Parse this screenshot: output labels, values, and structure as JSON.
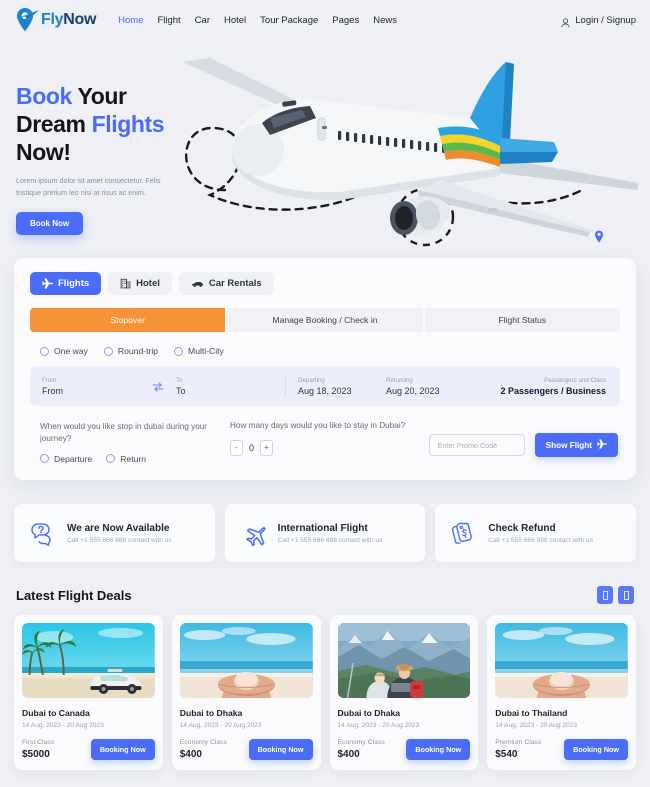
{
  "header": {
    "logo_text_a": "Fly",
    "logo_text_b": "Now",
    "logo_icon": "pin-plane-icon",
    "nav": [
      {
        "label": "Home",
        "active": true
      },
      {
        "label": "Flight",
        "active": false
      },
      {
        "label": "Car",
        "active": false
      },
      {
        "label": "Hotel",
        "active": false
      },
      {
        "label": "Tour Package",
        "active": false
      },
      {
        "label": "Pages",
        "active": false
      },
      {
        "label": "News",
        "active": false
      }
    ],
    "login_label": "Login / Signup",
    "user_icon": "user-icon"
  },
  "hero": {
    "title_line1_a": "Book",
    "title_line1_b": " Your",
    "title_line2_a": "Dream ",
    "title_line2_b": "Flights",
    "title_line3": "Now!",
    "subtitle": "Lorem ipsum dolor sit amet consectetur. Felis tristique pretium leo nisi at risus ac enim.",
    "cta_label": "Book Now",
    "airplane_icon": "airplane-illustration",
    "pin_icon": "location-pin-icon"
  },
  "booking": {
    "segment_tabs": [
      {
        "label": "Flights",
        "icon": "plane-icon",
        "active": true
      },
      {
        "label": "Hotel",
        "icon": "building-icon",
        "active": false
      },
      {
        "label": "Car Rentals",
        "icon": "car-icon",
        "active": false
      }
    ],
    "mode_tabs": [
      {
        "label": "Stopover",
        "active": true
      },
      {
        "label": "Manage Booking / Check in",
        "active": false
      },
      {
        "label": "Flight Status",
        "active": false
      }
    ],
    "trip_types": [
      {
        "label": "One way",
        "selected": false
      },
      {
        "label": "Round-trip",
        "selected": false
      },
      {
        "label": "Multi-City",
        "selected": false
      }
    ],
    "fields": {
      "from_label": "From",
      "from_value": "From",
      "to_label": "To",
      "to_value": "To",
      "swap_icon": "swap-arrows-icon",
      "departing_label": "Departing",
      "departing_value": "Aug 18, 2023",
      "returning_label": "Returning",
      "returning_value": "Aug 20, 2023",
      "passengers_label": "Passengers and Class",
      "passengers_value": "2 Passengers / Business"
    },
    "stopover_question": "When would you like stop in dubai during your journey?",
    "stopover_options": [
      {
        "label": "Departure",
        "selected": false
      },
      {
        "label": "Return",
        "selected": false
      }
    ],
    "days_question": "How many days would you like to stay in Dubai?",
    "days_minus": "-",
    "days_value": "0",
    "days_plus": "+",
    "promo_placeholder": "Enter Promo Code",
    "promo_value": "",
    "show_flight_label": "Show Flight",
    "show_flight_icon": "plane-icon"
  },
  "features": [
    {
      "title": "We are Now Available",
      "subtitle": "Call +1 555 666 888 contact with us",
      "icon": "chat-question-icon"
    },
    {
      "title": "International Flight",
      "subtitle": "Call +1 555 666 888 contact with us",
      "icon": "airplane-icon"
    },
    {
      "title": "Check Refund",
      "subtitle": "Call +1 555 666 888 contact with us",
      "icon": "price-tag-dollar-icon"
    }
  ],
  "deals_section": {
    "title": "Latest Flight Deals",
    "prev_icon": "chevron-left-icon",
    "next_icon": "chevron-right-icon",
    "cards": [
      {
        "name": "Dubai to Canada",
        "dates": "14 Aug, 2023 - 20 Aug 2023",
        "class": "First Class",
        "price": "$5000",
        "button": "Booking Now",
        "image": "beach-palms-car-photo"
      },
      {
        "name": "Dubai to Dhaka",
        "dates": "14 Aug, 2023 - 20 Aug 2023",
        "class": "Economy Class",
        "price": "$400",
        "button": "Booking Now",
        "image": "beach-sunhat-photo"
      },
      {
        "name": "Dubai to Dhaka",
        "dates": "14 Aug, 2023 - 20 Aug 2023",
        "class": "Economy Class",
        "price": "$400",
        "button": "Booking Now",
        "image": "mountain-hikers-photo"
      },
      {
        "name": "Dubai to Thailand",
        "dates": "14 Aug, 2023 - 20 Aug 2023",
        "class": "Premium Class",
        "price": "$540",
        "button": "Booking Now",
        "image": "beach-sunhat-photo"
      }
    ]
  },
  "colors": {
    "accent": "#4a6cf7",
    "orange": "#f79239",
    "page_bg": "#eef0f5",
    "panel_bg": "#fbfbfd",
    "field_bg": "#eceefb"
  }
}
